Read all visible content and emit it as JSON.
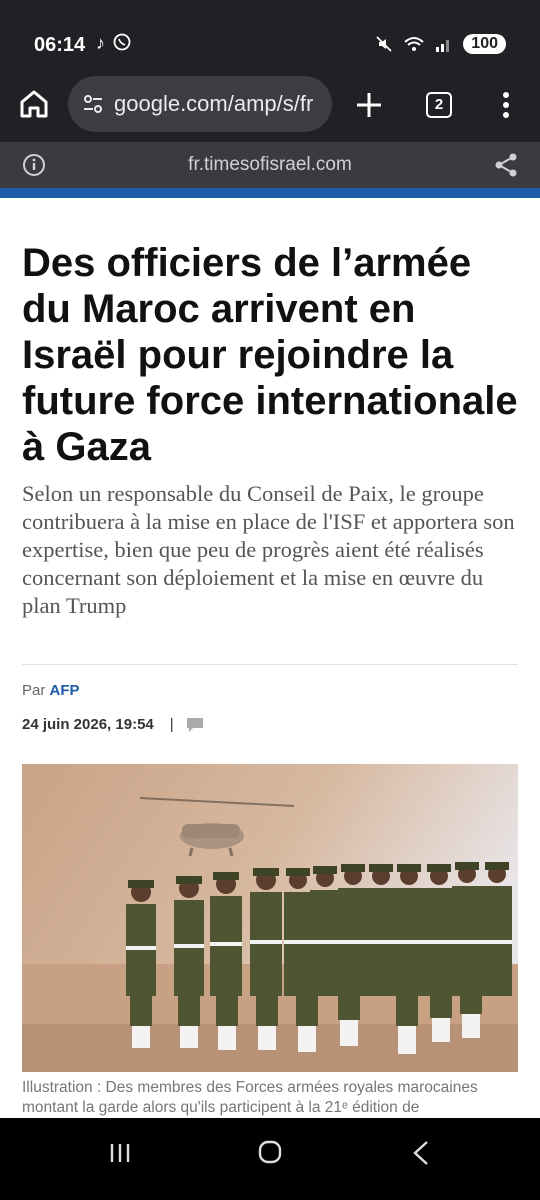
{
  "status_bar": {
    "time": "06:14",
    "battery": "100",
    "left_icons": [
      "tiktok-icon",
      "whatsapp-icon"
    ],
    "right_icons": [
      "mute-icon",
      "wifi-icon",
      "signal-icon",
      "battery-icon"
    ]
  },
  "browser": {
    "url": "google.com/amp/s/fr",
    "tab_count": "2"
  },
  "amp_header": {
    "domain": "fr.timesofisrael.com"
  },
  "article": {
    "headline": "Des officiers de l’armée du Maroc arrivent en Israël pour rejoindre la future force internationale à Gaza",
    "dek": "Selon un responsable du Conseil de Paix, le groupe contribuera à la mise en place de l'ISF et apportera son expertise, bien que peu de progrès aient été réalisés concernant son déploiement et la mise en œuvre du plan Trump",
    "byline_prefix": "Par",
    "author": "AFP",
    "date": "24 juin 2026, 19:54",
    "date_separator": "|",
    "caption": "Illustration : Des membres des Forces armées royales marocaines montant la garde alors qu'ils participent à la 21ᵉ édition de"
  },
  "colors": {
    "accent_blue": "#1e5ba6",
    "browser_bar": "#202124",
    "amp_bar": "#3a3b3f"
  }
}
